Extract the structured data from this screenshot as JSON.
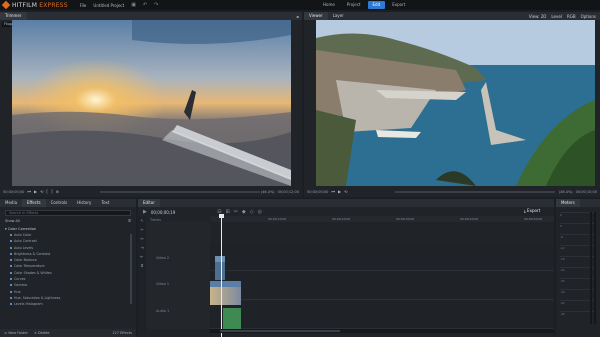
{
  "app": {
    "logo_prefix": "HITFILM",
    "logo_suffix": " EXPRESS"
  },
  "menu": [
    "File",
    "Untitled Project"
  ],
  "nav": [
    "Home",
    "Project",
    "Edit",
    "Export"
  ],
  "nav_active": "Edit",
  "trimmer": {
    "tab": "Trimmer",
    "file": "Flugzeug.mp4",
    "timecode": "00;00;00;00",
    "duration": "00;00;12;00",
    "zoom": "(46.4%)"
  },
  "viewer": {
    "tabs": [
      "Viewer",
      "Layer"
    ],
    "view_label": "View: 2D",
    "quality": "Level",
    "channels": "RGB",
    "options": "Options",
    "timecode": "00;00;00;00",
    "duration": "00;00;10;00",
    "zoom": "(46.4%)"
  },
  "effects_panel": {
    "tabs": [
      "Media",
      "Effects",
      "Controls",
      "History",
      "Text"
    ],
    "active_tab": "Effects",
    "search_placeholder": "Search in Effects",
    "show_all": "Show All",
    "group": "Color Correction",
    "items": [
      "Auto Color",
      "Auto Contrast",
      "Auto Levels",
      "Brightness & Contrast",
      "Color Balance",
      "Color Temperature",
      "Color Shades & Whites",
      "Curves",
      "Gamma",
      "Hue",
      "Hue, Saturation & Lightness",
      "Levels Histogram"
    ],
    "footer": [
      "New Folder",
      "Delete",
      "127 Effects"
    ]
  },
  "editor": {
    "tab": "Editor",
    "timecode": "00;00;00;19",
    "export": "Export",
    "tracks_label": "Tracks",
    "track_names": [
      "Video 2",
      "Video 1",
      "Audio 1"
    ],
    "ruler": [
      "00;00;10;00",
      "00;00;20;00",
      "00;00;30;00",
      "00;00;40;00",
      "00;00;50;00"
    ]
  },
  "meters": {
    "tab": "Meters",
    "scale": [
      "6",
      "0",
      "-6",
      "-12",
      "-18",
      "-24",
      "-30",
      "-36",
      "-42",
      "-48"
    ]
  },
  "colors": {
    "accent": "#2c7ad6",
    "brand": "#e06a1e",
    "audio_clip": "#3e8a52"
  }
}
